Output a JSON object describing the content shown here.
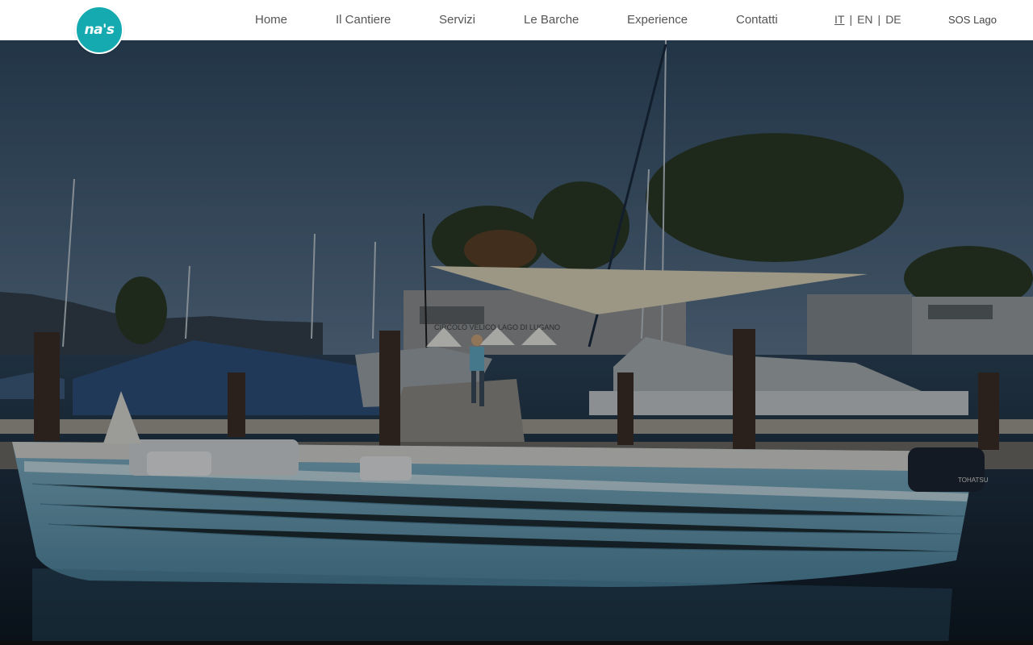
{
  "brand": {
    "logo_text": "na's",
    "logo_color": "#15aab0"
  },
  "nav": {
    "items": [
      {
        "label": "Home"
      },
      {
        "label": "Il Cantiere"
      },
      {
        "label": "Servizi"
      },
      {
        "label": "Le Barche"
      },
      {
        "label": "Experience"
      },
      {
        "label": "Contatti"
      }
    ]
  },
  "languages": {
    "items": [
      {
        "label": "IT",
        "active": true
      },
      {
        "label": "EN",
        "active": false
      },
      {
        "label": "DE",
        "active": false
      }
    ],
    "separator": "|"
  },
  "sos": {
    "label": "SOS Lago"
  },
  "hero": {
    "scene": "hero-photo-marina-boat",
    "sign_text": "CIRCOLO VELICO LAGO DI LUGANO",
    "motor_label": "TOHATSU"
  }
}
